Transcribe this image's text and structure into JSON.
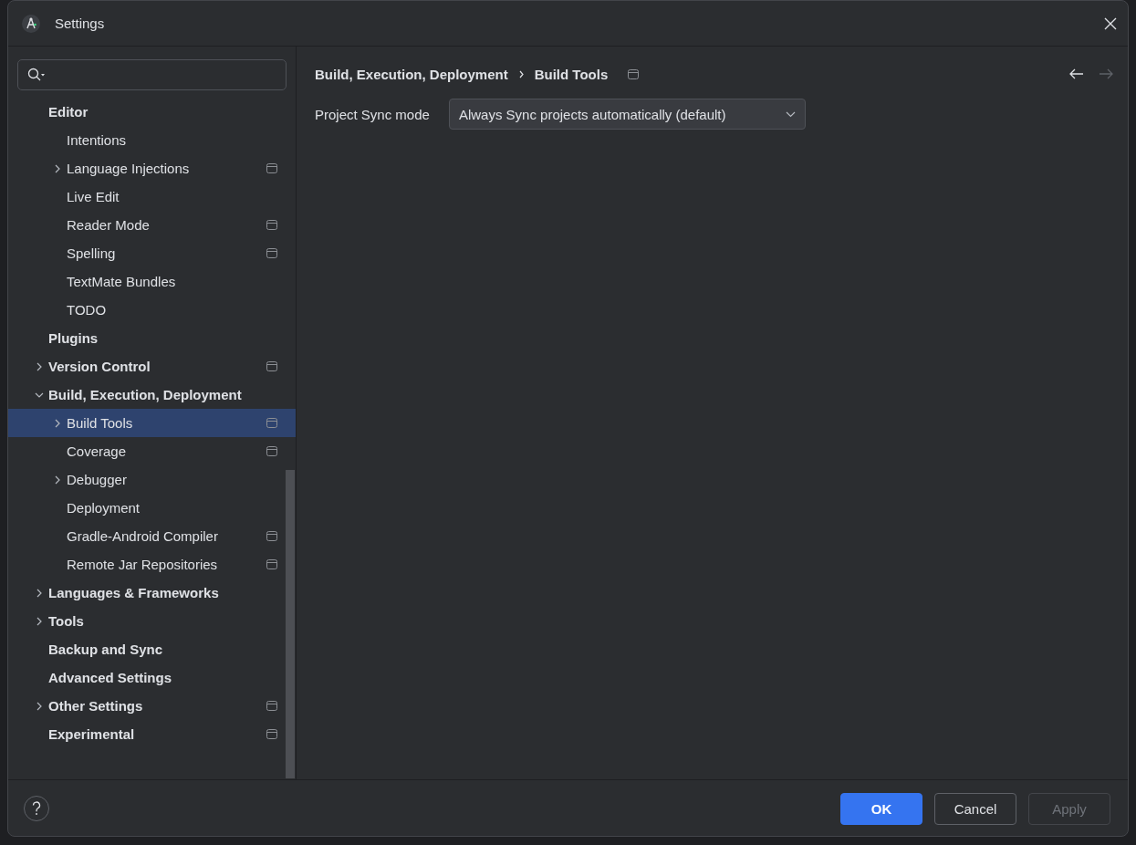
{
  "window": {
    "title": "Settings"
  },
  "sidebar": {
    "tree": [
      {
        "label": "Editor",
        "selected": false,
        "project_scope": false,
        "children": [
          {
            "label": "Intentions",
            "selected": false,
            "project_scope": false
          },
          {
            "label": "Language Injections",
            "expanded": false,
            "selected": false,
            "project_scope": true
          },
          {
            "label": "Live Edit",
            "selected": false,
            "project_scope": false
          },
          {
            "label": "Reader Mode",
            "selected": false,
            "project_scope": true
          },
          {
            "label": "Spelling",
            "selected": false,
            "project_scope": true
          },
          {
            "label": "TextMate Bundles",
            "selected": false,
            "project_scope": false
          },
          {
            "label": "TODO",
            "selected": false,
            "project_scope": false
          }
        ]
      },
      {
        "label": "Plugins",
        "selected": false,
        "project_scope": false
      },
      {
        "label": "Version Control",
        "expanded": false,
        "selected": false,
        "project_scope": true
      },
      {
        "label": "Build, Execution, Deployment",
        "expanded": true,
        "selected": false,
        "project_scope": false,
        "children": [
          {
            "label": "Build Tools",
            "expanded": false,
            "selected": true,
            "project_scope": true
          },
          {
            "label": "Coverage",
            "selected": false,
            "project_scope": true
          },
          {
            "label": "Debugger",
            "expanded": false,
            "selected": false,
            "project_scope": false
          },
          {
            "label": "Deployment",
            "selected": false,
            "project_scope": false
          },
          {
            "label": "Gradle-Android Compiler",
            "selected": false,
            "project_scope": true
          },
          {
            "label": "Remote Jar Repositories",
            "selected": false,
            "project_scope": true
          }
        ]
      },
      {
        "label": "Languages & Frameworks",
        "expanded": false,
        "selected": false,
        "project_scope": false
      },
      {
        "label": "Tools",
        "expanded": false,
        "selected": false,
        "project_scope": false
      },
      {
        "label": "Backup and Sync",
        "selected": false,
        "project_scope": false
      },
      {
        "label": "Advanced Settings",
        "selected": false,
        "project_scope": false
      },
      {
        "label": "Other Settings",
        "expanded": false,
        "selected": false,
        "project_scope": true
      },
      {
        "label": "Experimental",
        "selected": false,
        "project_scope": true
      }
    ]
  },
  "breadcrumb": {
    "items": [
      "Build, Execution, Deployment",
      "Build Tools"
    ],
    "project_scope": true
  },
  "nav": {
    "back_disabled": false,
    "forward_disabled": true
  },
  "content": {
    "fields": [
      {
        "label": "Project Sync mode",
        "value": "Always Sync projects automatically (default)"
      }
    ]
  },
  "buttons": [
    {
      "label": "OK",
      "kind": "primary",
      "disabled": false
    },
    {
      "label": "Cancel",
      "kind": "secondary",
      "disabled": false
    },
    {
      "label": "Apply",
      "kind": "secondary",
      "disabled": true
    }
  ]
}
